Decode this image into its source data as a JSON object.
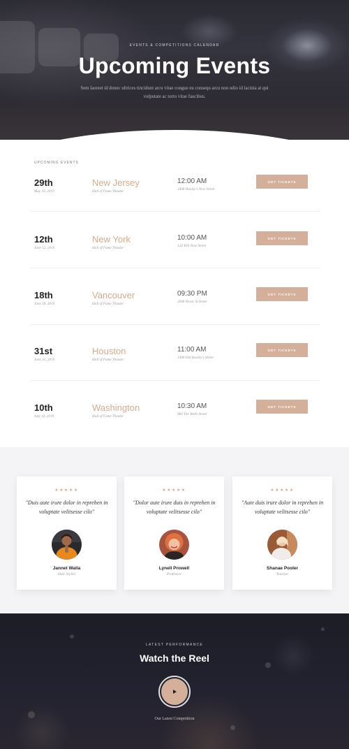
{
  "hero": {
    "subtitle": "EVENTS & COMPETITIONS CALENDAR",
    "title": "Upcoming Events",
    "description": "Sem laoreet id donec ultrices tincidunt arcu vitae congue eu consequ arcu non odio id lacinia at qui vulputate ac torto vitae faucibus."
  },
  "events": {
    "label": "UPCOMING EVENTS",
    "button_label": "GET TICKETS",
    "items": [
      {
        "day": "29th",
        "date": "May 29, 2019",
        "city": "New Jersey",
        "venue": "Hall of Fame Theater",
        "time": "12:00 AM",
        "address": "2408 Huxley's New Street"
      },
      {
        "day": "12th",
        "date": "June 12, 2019",
        "city": "New York",
        "venue": "Hall of Fame Theater",
        "time": "10:00 AM",
        "address": "124 Wilt New Street"
      },
      {
        "day": "18th",
        "date": "June 18, 2019",
        "city": "Vancouver",
        "venue": "Hall of Fame Theater",
        "time": "09:30 PM",
        "address": "2046 Never St Street"
      },
      {
        "day": "31st",
        "date": "June 31, 2019",
        "city": "Houston",
        "venue": "Hall of Fame Theater",
        "time": "11:00 AM",
        "address": "1408 Old Huxley's Street"
      },
      {
        "day": "10th",
        "date": "July 10, 2019",
        "city": "Washington",
        "venue": "Hall of Fame Theater",
        "time": "10:30 AM",
        "address": "984 The Wells Street"
      }
    ]
  },
  "testimonials": [
    {
      "stars": "★★★★★",
      "quote": "\"Duis aute irure dolor in reprehen in voluptate velitsesse cilo\"",
      "name": "Jannet Walla",
      "role": "Hair Stylist"
    },
    {
      "stars": "★★★★★",
      "quote": "\"Dolor aute irure duis in reprehen in voluptate velitsesse cilo\"",
      "name": "Lynell Prowell",
      "role": "Professor"
    },
    {
      "stars": "★★★★★",
      "quote": "\"Aute duis irure dolor in reprehen in voluptate velitsesse cilo\"",
      "name": "Shanae Pooler",
      "role": "Teacher"
    }
  ],
  "reel": {
    "subtitle": "LATEST PERFORMANCE",
    "title": "Watch the Reel",
    "play_icon": "play-icon",
    "caption": "Our Latest Competition"
  },
  "colors": {
    "accent": "#d4ab8e",
    "button": "#d4b09a",
    "hero_dark": "#2a2a33",
    "reel_dark": "#1d1d26"
  }
}
